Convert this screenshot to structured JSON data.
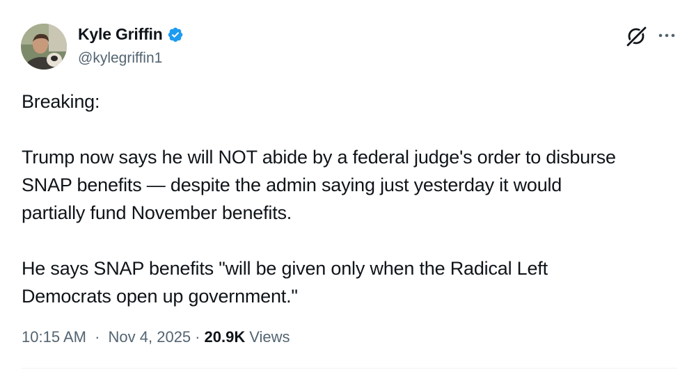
{
  "author": {
    "display_name": "Kyle Griffin",
    "handle": "@kylegriffin1",
    "verified": true,
    "verified_color": "#1d9bf0",
    "avatar_icon": "profile-photo"
  },
  "header_icons": {
    "grok": "grok-icon",
    "more": "more-options-icon"
  },
  "tweet": {
    "paragraphs": [
      "Breaking:",
      "Trump now says he will NOT abide by a federal judge's order to disburse\nSNAP benefits — despite the admin saying just yesterday it would\npartially fund November benefits.",
      "He says SNAP benefits \"will be given only when the Radical Left\nDemocrats open up government.\""
    ]
  },
  "meta": {
    "time": "10:15 AM",
    "separator": "·",
    "date": "Nov 4, 2025",
    "views_count": "20.9K",
    "views_label": "Views"
  },
  "colors": {
    "text_primary": "#0f1419",
    "text_secondary": "#536471",
    "divider": "#eff3f4"
  }
}
